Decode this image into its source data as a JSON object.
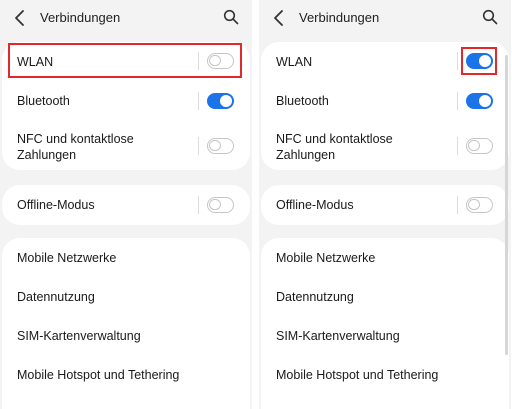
{
  "screens": [
    {
      "id": "before",
      "header": {
        "title": "Verbindungen",
        "back_icon": "chevron-left-icon",
        "search_icon": "search-icon"
      },
      "wlan": {
        "label": "WLAN",
        "toggle": "off"
      },
      "bluetooth": {
        "label": "Bluetooth",
        "toggle": "on"
      },
      "nfc": {
        "label_line1": "NFC und kontaktlose",
        "label_line2": "Zahlungen",
        "toggle": "off"
      },
      "offline": {
        "label": "Offline-Modus",
        "toggle": "off"
      },
      "menu": [
        "Mobile Netzwerke",
        "Datennutzung",
        "SIM-Kartenverwaltung",
        "Mobile Hotspot und Tethering"
      ]
    },
    {
      "id": "after",
      "header": {
        "title": "Verbindungen",
        "back_icon": "chevron-left-icon",
        "search_icon": "search-icon"
      },
      "wlan": {
        "label": "WLAN",
        "toggle": "on"
      },
      "bluetooth": {
        "label": "Bluetooth",
        "toggle": "on"
      },
      "nfc": {
        "label_line1": "NFC und kontaktlose",
        "label_line2": "Zahlungen",
        "toggle": "off"
      },
      "offline": {
        "label": "Offline-Modus",
        "toggle": "off"
      },
      "menu": [
        "Mobile Netzwerke",
        "Datennutzung",
        "SIM-Kartenverwaltung",
        "Mobile Hotspot und Tethering"
      ]
    }
  ],
  "colors": {
    "accent": "#1a73e8",
    "highlight": "#e3282c",
    "background": "#f3f3f3",
    "card": "#ffffff"
  }
}
